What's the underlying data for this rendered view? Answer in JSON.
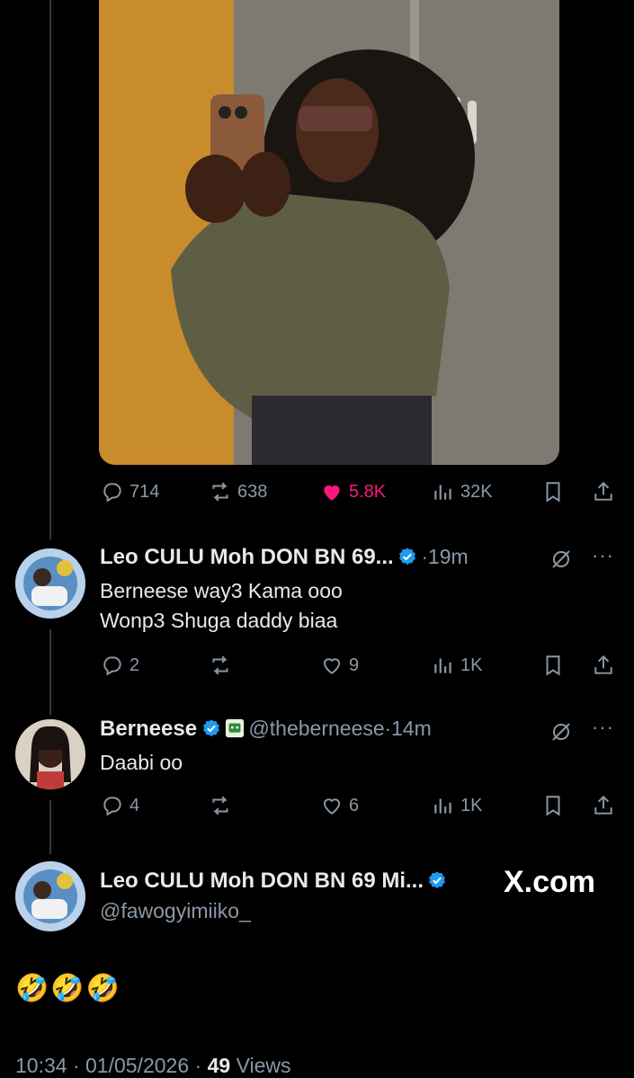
{
  "main_post": {
    "stats": {
      "replies": "714",
      "reposts": "638",
      "likes": "5.8K",
      "views": "32K"
    }
  },
  "replies": [
    {
      "name": "Leo CULU Moh DON BN 69...",
      "time_sep": "·",
      "time": "19m",
      "lines": [
        "Berneese way3 Kama ooo",
        "Wonp3 Shuga daddy biaa"
      ],
      "stats": {
        "replies": "2",
        "reposts": "",
        "likes": "9",
        "views": "1K"
      }
    },
    {
      "name": "Berneese",
      "handle": "@theberneese",
      "time_sep": "·",
      "time": "14m",
      "lines": [
        "Daabi oo"
      ],
      "stats": {
        "replies": "4",
        "reposts": "",
        "likes": "6",
        "views": "1K"
      }
    }
  ],
  "focused_post": {
    "name": "Leo CULU Moh DON BN 69 Mi...",
    "handle": "@fawogyimiiko_",
    "watermark": "X.com",
    "text": "🤣🤣🤣",
    "time": "10:34",
    "date": "01/05/2026",
    "sep": "·",
    "views_count": "49",
    "views_label": "Views"
  },
  "colors": {
    "accent": "#1d9bf0",
    "like": "#f91880",
    "muted": "#8b98a5",
    "text": "#e7e9ea"
  },
  "icons": [
    "reply-icon",
    "repost-icon",
    "heart-icon",
    "views-icon",
    "bookmark-icon",
    "share-icon",
    "grok-icon",
    "more-icon",
    "verified-icon",
    "affiliate-badge-icon"
  ]
}
